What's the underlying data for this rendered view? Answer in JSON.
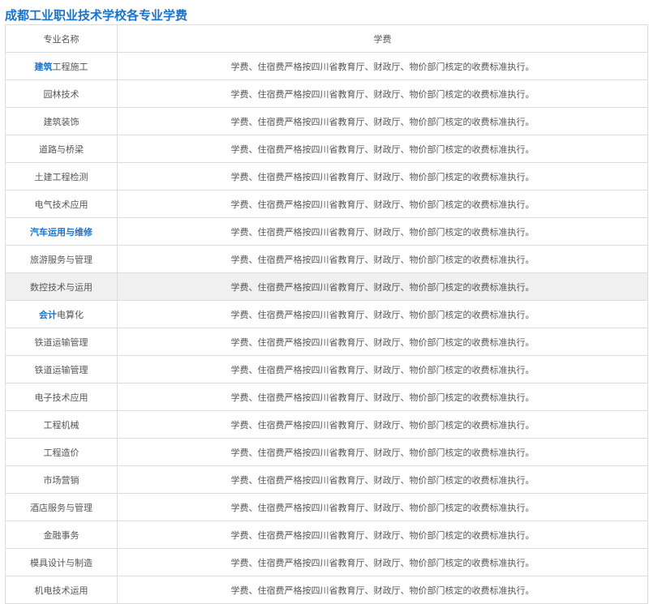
{
  "page_title": "成都工业职业技术学校各专业学费",
  "table": {
    "headers": [
      "专业名称",
      "学费"
    ],
    "fee_text": "学费、住宿费严格按四川省教育厅、财政厅、物价部门核定的收费标准执行。",
    "rows": [
      {
        "major_link": "建筑",
        "major": "工程施工",
        "highlight": false
      },
      {
        "major_link": "",
        "major": "园林技术",
        "highlight": false
      },
      {
        "major_link": "",
        "major": "建筑装饰",
        "highlight": false
      },
      {
        "major_link": "",
        "major": "道路与桥梁",
        "highlight": false
      },
      {
        "major_link": "",
        "major": "土建工程检测",
        "highlight": false
      },
      {
        "major_link": "",
        "major": "电气技术应用",
        "highlight": false
      },
      {
        "major_link": "汽车运用与维修",
        "major": "",
        "highlight": false
      },
      {
        "major_link": "",
        "major": "旅游服务与管理",
        "highlight": false
      },
      {
        "major_link": "",
        "major": "数控技术与运用",
        "highlight": true
      },
      {
        "major_link": "会计",
        "major": "电算化",
        "highlight": false
      },
      {
        "major_link": "",
        "major": "铁道运输管理",
        "highlight": false
      },
      {
        "major_link": "",
        "major": "铁道运输管理",
        "highlight": false
      },
      {
        "major_link": "",
        "major": "电子技术应用",
        "highlight": false
      },
      {
        "major_link": "",
        "major": "工程机械",
        "highlight": false
      },
      {
        "major_link": "",
        "major": "工程造价",
        "highlight": false
      },
      {
        "major_link": "",
        "major": "市场营销",
        "highlight": false
      },
      {
        "major_link": "",
        "major": "酒店服务与管理",
        "highlight": false
      },
      {
        "major_link": "",
        "major": "金融事务",
        "highlight": false
      },
      {
        "major_link": "",
        "major": "模具设计与制造",
        "highlight": false
      },
      {
        "major_link": "",
        "major": "机电技术运用",
        "highlight": false
      }
    ]
  }
}
